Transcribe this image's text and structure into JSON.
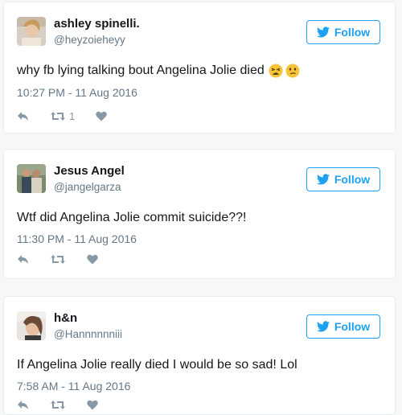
{
  "colors": {
    "accent": "#1da1f2",
    "text": "#14171a",
    "muted": "#657786",
    "icon": "#8899a6"
  },
  "tweets": [
    {
      "name": "ashley spinelli.",
      "handle": "@heyzoieheyy",
      "follow_label": "Follow",
      "text": "why fb lying talking bout Angelina Jolie died",
      "emojis": [
        "tired-face-emoji",
        "confused-face-emoji"
      ],
      "time": "10:27 PM - 11 Aug 2016",
      "retweet_count": "1"
    },
    {
      "name": "Jesus Angel",
      "handle": "@jangelgarza",
      "follow_label": "Follow",
      "text": "Wtf did Angelina Jolie commit suicide??!",
      "time": "11:30 PM - 11 Aug 2016",
      "retweet_count": ""
    },
    {
      "name": "h&n",
      "handle": "@Hannnnnniii",
      "follow_label": "Follow",
      "text": "If Angelina Jolie really died I would be so sad! Lol",
      "time": "7:58 AM - 11 Aug 2016",
      "retweet_count": ""
    }
  ],
  "icons": {
    "reply": "reply-icon",
    "retweet": "retweet-icon",
    "like": "heart-icon",
    "follow": "twitter-bird-icon"
  }
}
